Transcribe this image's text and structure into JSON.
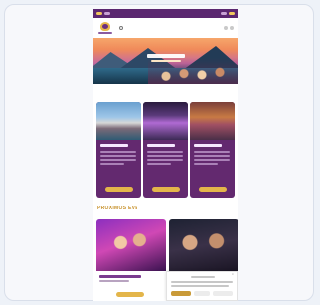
{
  "events": {
    "heading": "PRÓXIMOS EVENTOS"
  }
}
